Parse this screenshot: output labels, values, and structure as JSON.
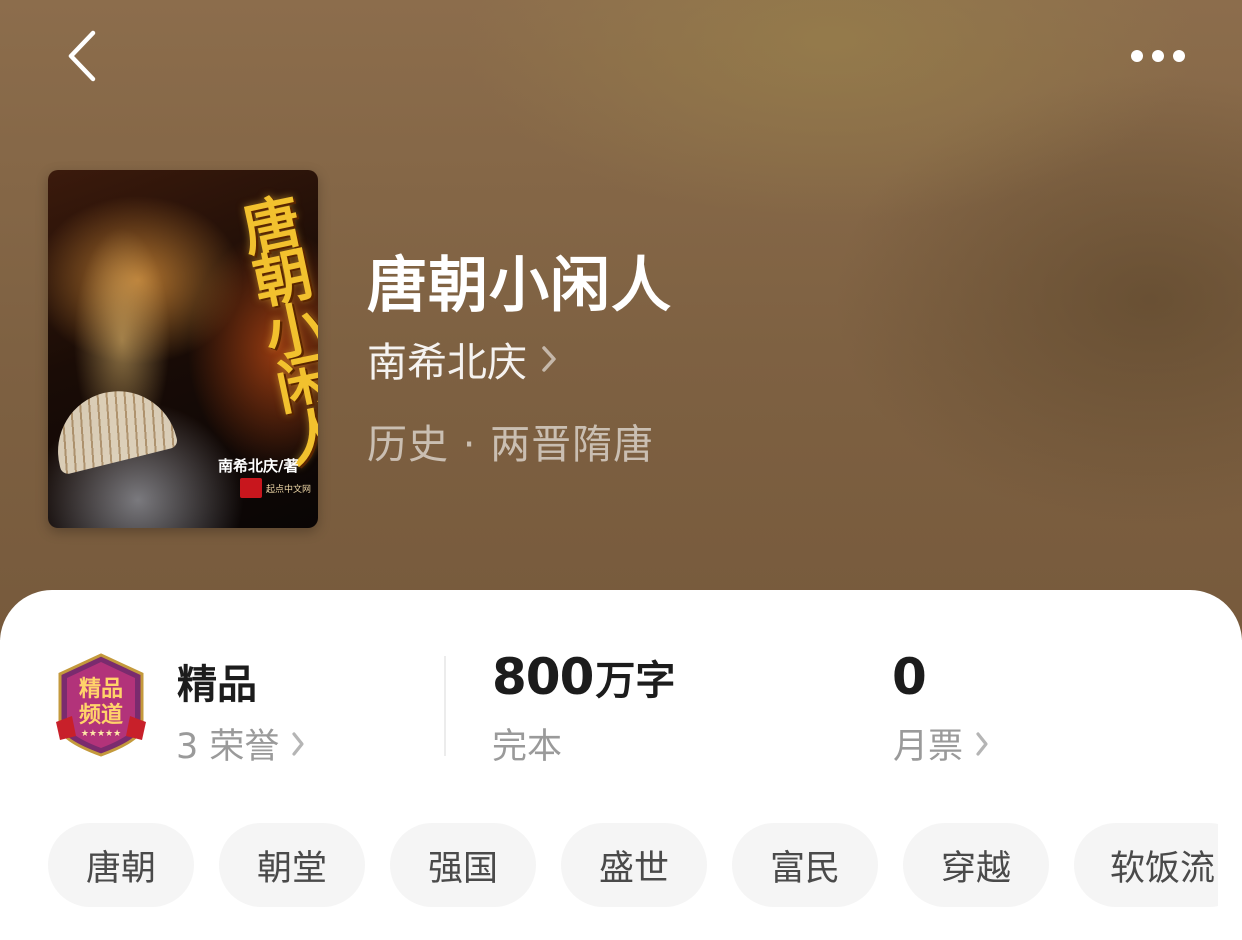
{
  "header": {
    "back_icon": "chevron-left-icon",
    "more_icon": "more-horizontal-icon"
  },
  "book": {
    "cover": {
      "title": "唐朝小闲人",
      "author_text": "南希北庆/著",
      "publisher": "起点中文网"
    },
    "title": "唐朝小闲人",
    "author": "南希北庆",
    "category": "历史 · 两晋隋唐"
  },
  "stats": {
    "badge": {
      "icon": "premium-channel-badge-icon",
      "text": "精品频道"
    },
    "quality": {
      "label": "精品",
      "honors": "3 荣誉"
    },
    "words": {
      "number": "800",
      "unit": "万字",
      "status": "完本"
    },
    "tickets": {
      "value": "0",
      "label": "月票"
    }
  },
  "tags": [
    "唐朝",
    "朝堂",
    "强国",
    "盛世",
    "富民",
    "穿越",
    "软饭流"
  ],
  "colors": {
    "accent_gold": "#f2c12e",
    "badge_purple": "#7a2b6e",
    "badge_red": "#c8202a"
  }
}
